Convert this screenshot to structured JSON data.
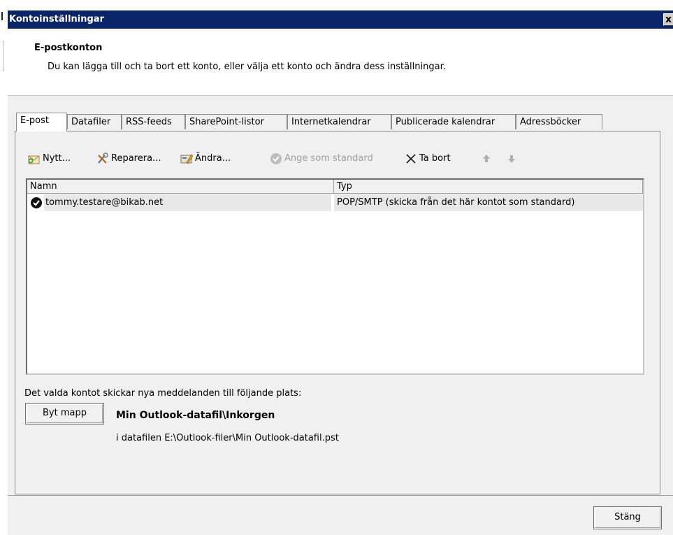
{
  "window": {
    "title": "Kontoinställningar",
    "close_glyph": "x"
  },
  "header": {
    "title": "E-postkonton",
    "subtitle": "Du kan lägga till och ta bort ett konto, eller välja ett konto och ändra dess inställningar."
  },
  "tabs": [
    {
      "label": "E-post",
      "active": true
    },
    {
      "label": "Datafiler"
    },
    {
      "label": "RSS-feeds"
    },
    {
      "label": "SharePoint-listor"
    },
    {
      "label": "Internetkalendrar"
    },
    {
      "label": "Publicerade kalendrar"
    },
    {
      "label": "Adressböcker"
    }
  ],
  "toolbar": {
    "new_label": "Nytt...",
    "repair_label": "Reparera...",
    "change_label": "Ändra...",
    "set_default_label": "Ange som standard",
    "remove_label": "Ta bort"
  },
  "list": {
    "columns": [
      "Namn",
      "Typ"
    ],
    "rows": [
      {
        "name": "tommy.testare@bikab.net",
        "type": "POP/SMTP (skicka från det här kontot som standard)"
      }
    ]
  },
  "delivery": {
    "info": "Det valda kontot skickar nya meddelanden till följande plats:",
    "change_folder_label": "Byt mapp",
    "folder": "Min Outlook-datafil\\Inkorgen",
    "datafile": "i datafilen E:\\Outlook-filer\\Min Outlook-datafil.pst"
  },
  "footer": {
    "close_label": "Stäng"
  },
  "colors": {
    "titlebar": "#0a246a",
    "dialog_bg": "#f0f0f0",
    "selected_row": "#e8e8e8"
  },
  "icons": [
    "new-account-icon",
    "repair-icon",
    "change-icon",
    "set-default-icon",
    "remove-icon",
    "move-up-icon",
    "move-down-icon",
    "default-account-check-icon"
  ]
}
